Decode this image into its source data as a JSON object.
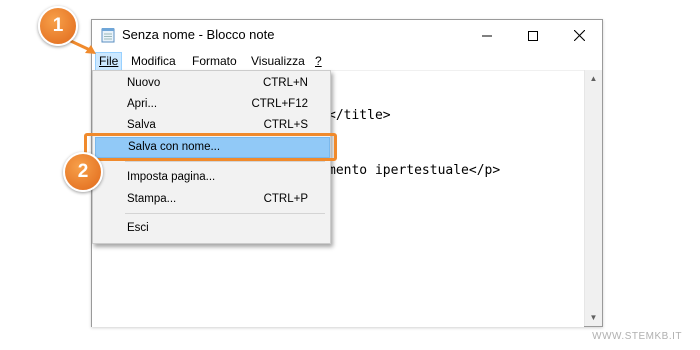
{
  "window": {
    "title": "Senza nome - Blocco note"
  },
  "menubar": {
    "items": [
      "File",
      "Modifica",
      "Formato",
      "Visualizza",
      "?"
    ],
    "access_keys": [
      "F",
      "M",
      "o",
      "V",
      ""
    ]
  },
  "editor": {
    "lines": [
      "</title>",
      "mento ipertestuale</p>"
    ]
  },
  "file_menu": {
    "items": [
      {
        "label": "Nuovo",
        "shortcut": "CTRL+N"
      },
      {
        "label": "Apri...",
        "shortcut": "CTRL+F12"
      },
      {
        "label": "Salva",
        "shortcut": "CTRL+S"
      },
      {
        "label": "Salva con nome...",
        "shortcut": ""
      },
      {
        "label": "Imposta pagina...",
        "shortcut": ""
      },
      {
        "label": "Stampa...",
        "shortcut": "CTRL+P"
      },
      {
        "label": "Esci",
        "shortcut": ""
      }
    ]
  },
  "annotations": {
    "step1": "1",
    "step2": "2"
  },
  "watermark": "WWW.STEMKB.IT",
  "colors": {
    "accent": "#f08a2c",
    "menu_highlight": "#91c9f7",
    "menu_active": "#cce8ff"
  }
}
